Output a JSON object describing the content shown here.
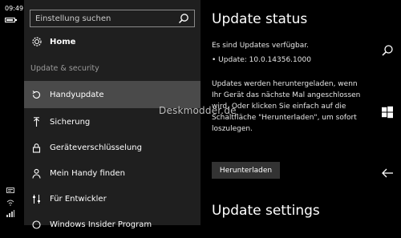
{
  "statusbar": {
    "time": "09:49",
    "battery_level": 0.85,
    "icons": [
      "notification-icon",
      "wifi-icon",
      "signal-icon"
    ]
  },
  "nav": {
    "search_placeholder": "Einstellung suchen",
    "home_label": "Home",
    "section_label": "Update & security",
    "items": [
      {
        "label": "Handyupdate",
        "icon": "refresh-icon",
        "active": true
      },
      {
        "label": "Sicherung",
        "icon": "upload-icon",
        "active": false
      },
      {
        "label": "Geräteverschlüsselung",
        "icon": "lock-icon",
        "active": false
      },
      {
        "label": "Mein Handy finden",
        "icon": "person-icon",
        "active": false
      },
      {
        "label": "Für Entwickler",
        "icon": "sliders-icon",
        "active": false
      },
      {
        "label": "Windows Insider Program",
        "icon": "insider-icon",
        "active": false
      }
    ]
  },
  "main": {
    "title": "Update status",
    "available": "Es sind Updates verfügbar.",
    "update_line": "• Update: 10.0.14356.1000",
    "description_lines": [
      "Updates werden heruntergeladen, wenn",
      "Ihr Gerät das nächste Mal angeschlossen",
      "wird. Oder klicken Sie einfach auf die",
      "Schaltfläche \"Herunterladen\", um sofort",
      "loszulegen."
    ],
    "download_button": "Herunterladen",
    "settings_title": "Update settings"
  },
  "watermark": "Deskmodder.de",
  "rightbar": {
    "icons": [
      "search-icon",
      "windows-icon",
      "back-arrow-icon"
    ]
  }
}
